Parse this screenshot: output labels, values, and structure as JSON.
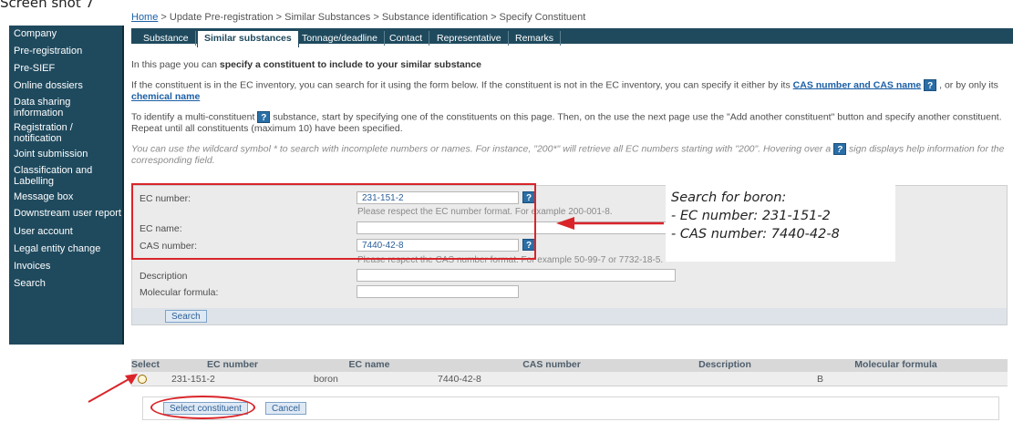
{
  "caption": "Screen shot 7",
  "breadcrumb": {
    "home": "Home",
    "rest": " > Update Pre-registration > Similar Substances > Substance identification > Specify Constituent"
  },
  "sidebar": {
    "items": [
      "Company",
      "Pre-registration",
      "Pre-SIEF",
      "Online dossiers",
      "Data sharing information",
      "Registration / notification",
      "Joint submission",
      "Classification and Labelling",
      "Message box",
      "Downstream user report",
      "User account",
      "Legal entity change",
      "Invoices",
      "Search"
    ]
  },
  "tabs": [
    "Substance",
    "Similar substances",
    "Tonnage/deadline",
    "Contact",
    "Representative",
    "Remarks"
  ],
  "intro": {
    "p1_pre": "In this page you can ",
    "p1_bold": "specify a constituent to include to your similar substance",
    "p2_pre": "If the constituent is in the EC inventory, you can search for it using the form below. If the constituent is not in the EC inventory, you can specify it either by its ",
    "p2_link1": "CAS number and CAS name",
    "p2_mid": " , or by only its ",
    "p2_link2": "chemical name",
    "p3_pre": "To identify a multi-constituent ",
    "p3_post": " substance, start by specifying one of the constituents on this page. Then, on the use the next page use the \"Add another constituent\" button and specify another constituent. Repeat until all constituents (maximum 10) have been specified.",
    "p4_pre": "You can use the wildcard symbol * to search with incomplete numbers or names. For instance, \"200*\" will retrieve all EC numbers starting with \"200\". Hovering over a ",
    "p4_post": " sign displays help information for the corresponding field.",
    "help_glyph": "?"
  },
  "form": {
    "ec_number_label": "EC number:",
    "ec_number_value": "231-151-2",
    "ec_hint": "Please respect the EC number format. For example 200-001-8.",
    "ec_name_label": "EC name:",
    "cas_label": "CAS number:",
    "cas_value": "7440-42-8",
    "cas_hint": "Please respect the CAS number format. For example 50-99-7 or 7732-18-5.",
    "description_label": "Description",
    "formula_label": "Molecular formula:",
    "search_button": "Search"
  },
  "annotation": {
    "line1": "Search for boron:",
    "line2": "- EC number: 231-151-2",
    "line3": "- CAS number: 7440-42-8"
  },
  "results": {
    "headers": [
      "Select",
      "EC number",
      "EC name",
      "CAS number",
      "Description",
      "Molecular formula"
    ],
    "row": {
      "ec_number": "231-151-2",
      "ec_name": "boron",
      "cas_number": "7440-42-8",
      "description": "",
      "formula": "B"
    }
  },
  "actions": {
    "select_constituent": "Select constituent",
    "cancel": "Cancel"
  },
  "colors": {
    "nav_bg": "#1f4a5e",
    "highlight_red": "#d9252a",
    "link_blue": "#1b5fa6"
  }
}
